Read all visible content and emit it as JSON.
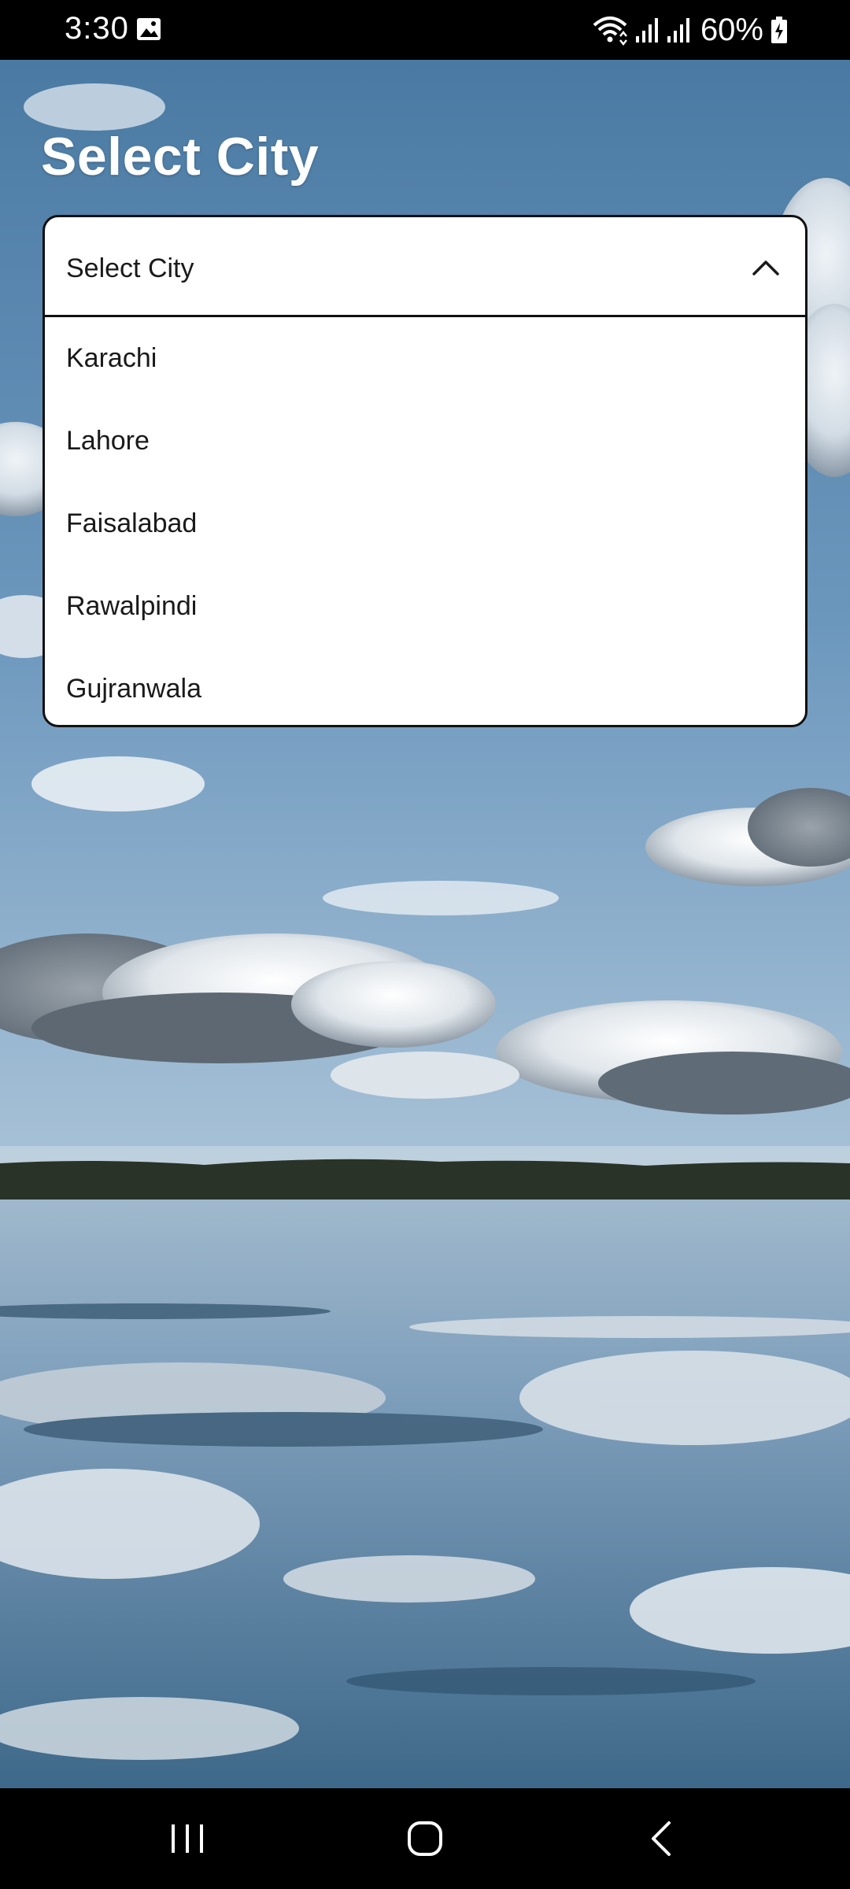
{
  "status_bar": {
    "time": "3:30",
    "battery": "60%",
    "icons": [
      "gallery-icon",
      "wifi-icon",
      "signal-icon",
      "signal-icon",
      "battery-charging-icon"
    ]
  },
  "page": {
    "title": "Select City"
  },
  "dropdown": {
    "label": "Select City",
    "expanded": true,
    "options": [
      "Karachi",
      "Lahore",
      "Faisalabad",
      "Rawalpindi",
      "Gujranwala"
    ]
  },
  "nav_bar": {
    "icons": [
      "recent-apps-icon",
      "home-icon",
      "back-icon"
    ]
  },
  "colors": {
    "sky_top": "#4f7fa8",
    "sky_mid": "#7fa6c6",
    "water": "#6e93b2",
    "tree_line": "#2b3328",
    "dropdown_bg": "#ffffff",
    "dropdown_border": "#111111"
  }
}
